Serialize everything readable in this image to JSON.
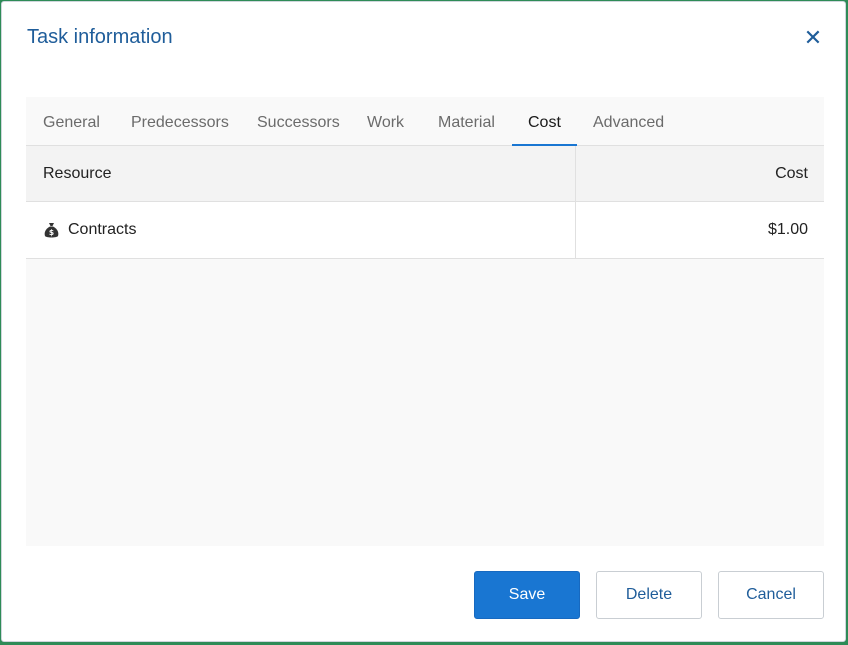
{
  "dialog": {
    "title": "Task information",
    "close_icon": "close-icon"
  },
  "tabs": [
    {
      "label": "General",
      "active": false
    },
    {
      "label": "Predecessors",
      "active": false
    },
    {
      "label": "Successors",
      "active": false
    },
    {
      "label": "Work",
      "active": false
    },
    {
      "label": "Material",
      "active": false
    },
    {
      "label": "Cost",
      "active": true
    },
    {
      "label": "Advanced",
      "active": false
    }
  ],
  "grid": {
    "columns": {
      "resource": "Resource",
      "cost": "Cost"
    },
    "rows": [
      {
        "icon": "money-bag-icon",
        "resource": "Contracts",
        "cost": "$1.00"
      }
    ]
  },
  "buttons": {
    "save": "Save",
    "delete": "Delete",
    "cancel": "Cancel"
  },
  "colors": {
    "accent": "#1976d2",
    "title": "#1f5d9a"
  }
}
